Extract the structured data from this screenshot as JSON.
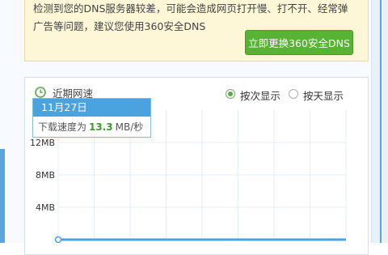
{
  "warning": {
    "line1": "检测到您的DNS服务器较差，可能会造成网页打开慢、打不开、经常弹",
    "line2": "广告等问题，建议您使用360安全DNS",
    "button": "立即更换360安全DNS"
  },
  "panel": {
    "title": "近期网速",
    "view_options": [
      {
        "label": "按次显示",
        "selected": true
      },
      {
        "label": "按天显示",
        "selected": false
      }
    ]
  },
  "tooltip": {
    "date": "11月27日",
    "label": "下载速度为",
    "value": "13.3",
    "unit": "MB/秒"
  },
  "chart_data": {
    "type": "line",
    "xlabel": "",
    "ylabel": "",
    "y_ticks": [
      "12MB",
      "8MB",
      "4MB"
    ],
    "y_tick_values": [
      12,
      8,
      4
    ],
    "ylim": [
      0,
      16
    ],
    "grid": true,
    "series": [
      {
        "values": [
          0,
          13.3
        ]
      }
    ]
  },
  "colors": {
    "accent_blue": "#4aa3df",
    "button_green": "#58b233",
    "value_green": "#3c9a2c",
    "warning_bg": "#fdf6d7"
  }
}
